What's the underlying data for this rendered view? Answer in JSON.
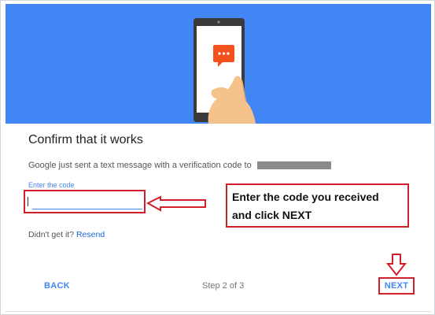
{
  "dialog": {
    "title": "Confirm that it works",
    "message": "Google just sent a text message with a verification code to",
    "code_label": "Enter the code",
    "code_value": "",
    "resend_prefix": "Didn't get it? ",
    "resend_link": "Resend"
  },
  "footer": {
    "back_label": "BACK",
    "step_text": "Step 2 of 3",
    "next_label": "NEXT"
  },
  "annotation": {
    "line1": "Enter the code you received",
    "line2": "and click NEXT"
  },
  "colors": {
    "banner": "#4285f4",
    "accent": "#4285f4",
    "annotation_red": "#d0202c"
  },
  "icons": {
    "banner_illustration": "phone-message-icon"
  }
}
